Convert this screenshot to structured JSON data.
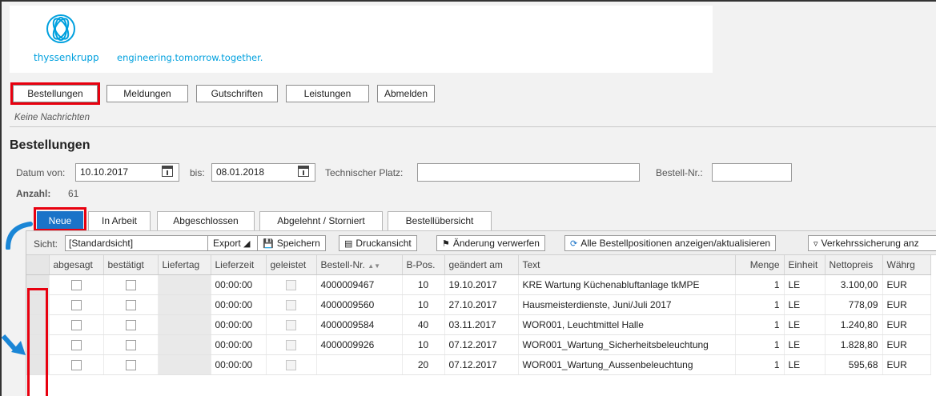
{
  "brand": {
    "name": "thyssenkrupp",
    "tagline": "engineering.tomorrow.together.",
    "color": "#00a0de"
  },
  "nav": [
    {
      "label": "Bestellungen",
      "highlighted": true
    },
    {
      "label": "Meldungen"
    },
    {
      "label": "Gutschriften"
    },
    {
      "label": "Leistungen"
    },
    {
      "label": "Abmelden"
    }
  ],
  "message": "Keine Nachrichten",
  "page_title": "Bestellungen",
  "filters": {
    "date_from_label": "Datum von:",
    "date_from": "10.10.2017",
    "date_to_label": "bis:",
    "date_to": "08.01.2018",
    "tech_place_label": "Technischer Platz:",
    "tech_place": "",
    "order_no_label": "Bestell-Nr.:",
    "order_no": ""
  },
  "count_label": "Anzahl:",
  "count_value": "61",
  "tabs": [
    {
      "label": "Neue",
      "active": true
    },
    {
      "label": "In Arbeit"
    },
    {
      "label": "Abgeschlossen"
    },
    {
      "label": "Abgelehnt / Storniert"
    },
    {
      "label": "Bestellübersicht"
    }
  ],
  "toolbar": {
    "view_label": "Sicht:",
    "view_value": "[Standardsicht]",
    "export": "Export",
    "save": "Speichern",
    "print": "Druckansicht",
    "discard": "Änderung verwerfen",
    "show_all": "Alle Bestellpositionen anzeigen/aktualisieren",
    "traffic": "Verkehrssicherung anz"
  },
  "columns": [
    "abgesagt",
    "bestätigt",
    "Liefertag",
    "Lieferzeit",
    "geleistet",
    "Bestell-Nr.",
    "B-Pos.",
    "geändert am",
    "Text",
    "Menge",
    "Einheit",
    "Nettopreis",
    "Währg"
  ],
  "rows": [
    {
      "lieferzeit": "00:00:00",
      "bestell_nr": "4000009467",
      "pos": "10",
      "date": "19.10.2017",
      "text": "KRE Wartung Küchenabluftanlage tkMPE",
      "menge": "1",
      "einheit": "LE",
      "preis": "3.100,00",
      "waehrung": "EUR"
    },
    {
      "lieferzeit": "00:00:00",
      "bestell_nr": "4000009560",
      "pos": "10",
      "date": "27.10.2017",
      "text": "Hausmeisterdienste, Juni/Juli 2017",
      "menge": "1",
      "einheit": "LE",
      "preis": "778,09",
      "waehrung": "EUR"
    },
    {
      "lieferzeit": "00:00:00",
      "bestell_nr": "4000009584",
      "pos": "40",
      "date": "03.11.2017",
      "text": "WOR001, Leuchtmittel Halle",
      "menge": "1",
      "einheit": "LE",
      "preis": "1.240,80",
      "waehrung": "EUR"
    },
    {
      "lieferzeit": "00:00:00",
      "bestell_nr": "4000009926",
      "pos": "10",
      "date": "07.12.2017",
      "text": "WOR001_Wartung_Sicherheitsbeleuchtung",
      "menge": "1",
      "einheit": "LE",
      "preis": "1.828,80",
      "waehrung": "EUR"
    },
    {
      "lieferzeit": "00:00:00",
      "bestell_nr": "",
      "pos": "20",
      "date": "07.12.2017",
      "text": "WOR001_Wartung_Aussenbeleuchtung",
      "menge": "1",
      "einheit": "LE",
      "preis": "595,68",
      "waehrung": "EUR"
    }
  ],
  "colors": {
    "highlight": "#e8000f",
    "active_tab": "#1a73c8",
    "arrow": "#1a86d6"
  }
}
